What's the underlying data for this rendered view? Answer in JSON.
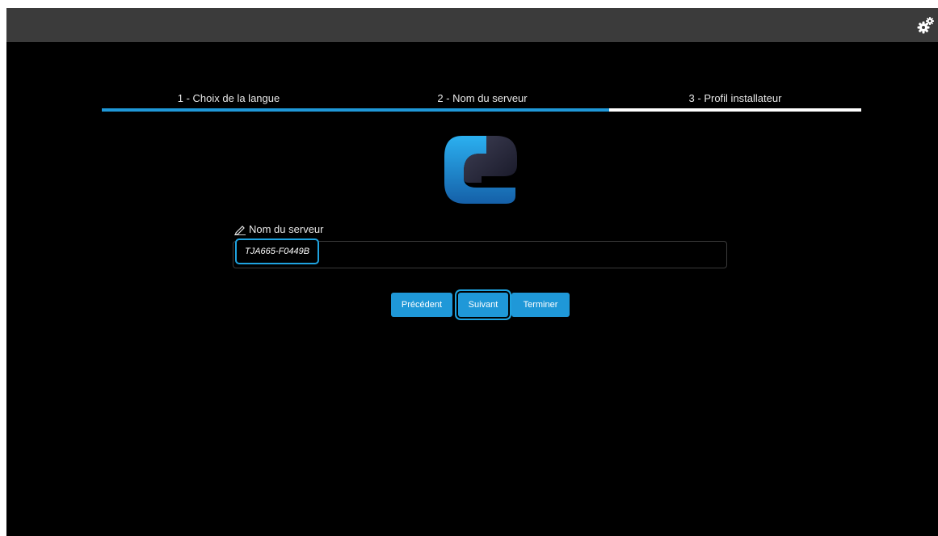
{
  "settings_icon": "gears-icon",
  "steps": [
    {
      "label": "1 - Choix de la langue",
      "state": "done"
    },
    {
      "label": "2 - Nom du serveur",
      "state": "active"
    },
    {
      "label": "3 - Profil installateur",
      "state": "pending"
    }
  ],
  "colors": {
    "accent": "#1f98d8",
    "pending_bar": "#ffffff",
    "background": "#000000",
    "topbar": "#3b3b3b"
  },
  "logo_icon": "e-logo",
  "form": {
    "label": "Nom du serveur",
    "label_icon": "pencil-icon",
    "value": "TJA665-F0449B"
  },
  "buttons": {
    "previous": "Précédent",
    "next": "Suivant",
    "finish": "Terminer"
  }
}
